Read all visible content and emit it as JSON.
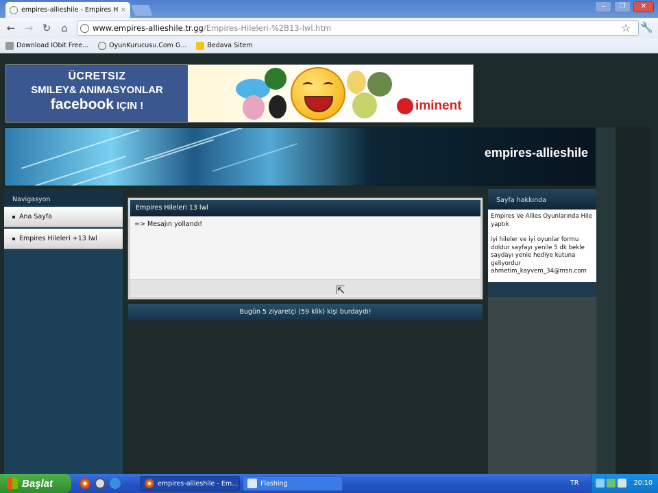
{
  "browser": {
    "tab_title": "empires-allieshile - Empires Hil",
    "tab_close": "×",
    "url_host": "www.empires-allieshile.tr.gg",
    "url_path": "/Empires-Hileleri-%2B13-lwl.htm",
    "bookmarks": [
      "Download IObit Free...",
      "OyunKurucusu.Com G...",
      "Bedava Sitem"
    ]
  },
  "ad": {
    "line1": "ÜCRETSIZ",
    "line2": "SMILEY& ANIMASYONLAR",
    "line3_brand": "facebook",
    "line3_rest": " IÇIN !",
    "logo": "iminent"
  },
  "site": {
    "title": "empires-allieshile"
  },
  "nav": {
    "heading": "Navigasyon",
    "items": [
      "Ana Sayfa",
      "Empires Hileleri +13 lwl"
    ]
  },
  "main": {
    "box_title": "Empires Hileleri 13 lwl",
    "message": "=> Mesajın yollandı!",
    "counter": "Bugün 5 ziyaretçi (59 klik) kişi burdaydı!"
  },
  "about": {
    "heading": "Sayfa hakkında",
    "p1": "Empires Ve Allies Oyunlarında Hile yaptık",
    "p2": "iyi hileler ve iyi oyunlar formu doldur sayfayı yenile 5 dk bekle saydayı yenie hediye kutuna geliyordur ahmetim_kayvem_34@msn.com"
  },
  "taskbar": {
    "start_label": "Başlat",
    "tasks": [
      "empires-allieshile - Em...",
      "Flashing"
    ],
    "lang": "TR",
    "clock": "20:10"
  }
}
